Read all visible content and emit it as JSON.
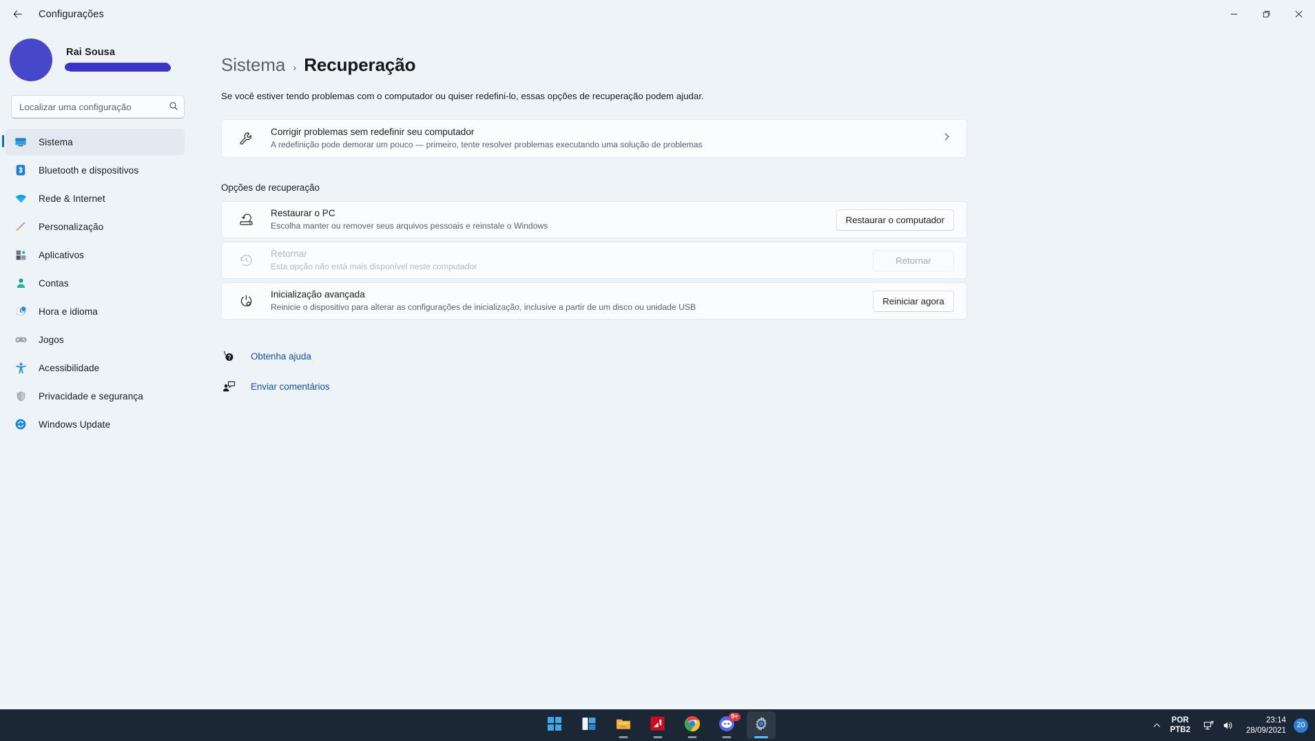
{
  "window": {
    "title": "Configurações",
    "back_icon": "arrow-left-icon",
    "minimize_label": "—",
    "maximize_label": "▢",
    "close_label": "✕"
  },
  "sidebar": {
    "profile": {
      "name": "Rai Sousa",
      "email_redacted": true
    },
    "search": {
      "placeholder": "Localizar uma configuração",
      "value": "",
      "icon": "search-icon"
    },
    "items": [
      {
        "label": "Sistema",
        "icon": "monitor-icon",
        "active": true
      },
      {
        "label": "Bluetooth e dispositivos",
        "icon": "bluetooth-icon",
        "active": false
      },
      {
        "label": "Rede & Internet",
        "icon": "wifi-icon",
        "active": false
      },
      {
        "label": "Personalização",
        "icon": "paintbrush-icon",
        "active": false
      },
      {
        "label": "Aplicativos",
        "icon": "apps-icon",
        "active": false
      },
      {
        "label": "Contas",
        "icon": "person-icon",
        "active": false
      },
      {
        "label": "Hora e idioma",
        "icon": "clock-icon",
        "active": false
      },
      {
        "label": "Jogos",
        "icon": "gamepad-icon",
        "active": false
      },
      {
        "label": "Acessibilidade",
        "icon": "accessibility-icon",
        "active": false
      },
      {
        "label": "Privacidade e segurança",
        "icon": "shield-icon",
        "active": false
      },
      {
        "label": "Windows Update",
        "icon": "update-icon",
        "active": false
      }
    ]
  },
  "main": {
    "breadcrumb": {
      "parent": "Sistema",
      "separator": "›",
      "current": "Recuperação"
    },
    "description": "Se você estiver tendo problemas com o computador ou quiser redefini-lo, essas opções de recuperação podem ajudar.",
    "hero_card": {
      "icon": "wrench-icon",
      "title": "Corrigir problemas sem redefinir seu computador",
      "subtitle": "A redefinição pode demorar um pouco — primeiro, tente resolver problemas executando uma solução de problemas",
      "chevron": "chevron-right-icon"
    },
    "section_label": "Opções de recuperação",
    "rows": [
      {
        "icon": "reset-pc-icon",
        "title": "Restaurar o PC",
        "subtitle": "Escolha manter ou remover seus arquivos pessoais e reinstale o Windows",
        "button": "Restaurar o computador",
        "disabled": false
      },
      {
        "icon": "history-icon",
        "title": "Retornar",
        "subtitle": "Esta opção não está mais disponível neste computador",
        "button": "Retornar",
        "disabled": true
      },
      {
        "icon": "power-restart-icon",
        "title": "Inicialização avançada",
        "subtitle": "Reinicie o dispositivo para alterar as configurações de inicialização, inclusive a partir de um disco ou unidade USB",
        "button": "Reiniciar agora",
        "disabled": false
      }
    ],
    "help_links": [
      {
        "label": "Obtenha ajuda",
        "icon": "help-icon"
      },
      {
        "label": "Enviar comentários",
        "icon": "feedback-icon"
      }
    ]
  },
  "taskbar": {
    "items": [
      {
        "name": "start",
        "icon": "windows-start-icon",
        "active": false,
        "running": false,
        "badge": ""
      },
      {
        "name": "widgets",
        "icon": "widgets-icon",
        "active": false,
        "running": false,
        "badge": ""
      },
      {
        "name": "file-explorer",
        "icon": "folder-icon",
        "active": false,
        "running": true,
        "badge": ""
      },
      {
        "name": "amd-software",
        "icon": "amd-icon",
        "active": false,
        "running": true,
        "badge": ""
      },
      {
        "name": "google-chrome",
        "icon": "chrome-icon",
        "active": false,
        "running": true,
        "badge": ""
      },
      {
        "name": "discord",
        "icon": "discord-icon",
        "active": false,
        "running": true,
        "badge": "9+"
      },
      {
        "name": "settings",
        "icon": "gear-icon",
        "active": true,
        "running": true,
        "badge": ""
      }
    ],
    "tray": {
      "overflow_icon": "chevron-up-icon",
      "language_top": "POR",
      "language_bottom": "PTB2",
      "network_icon": "network-icon",
      "volume_icon": "volume-icon",
      "time": "23:14",
      "date": "28/09/2021",
      "notification_count": "20"
    }
  },
  "colors": {
    "accent": "#0f6cbd",
    "link": "#1053a4",
    "background": "#eef3f8",
    "card": "#fbfcfd",
    "taskbar": "#1b2735"
  }
}
